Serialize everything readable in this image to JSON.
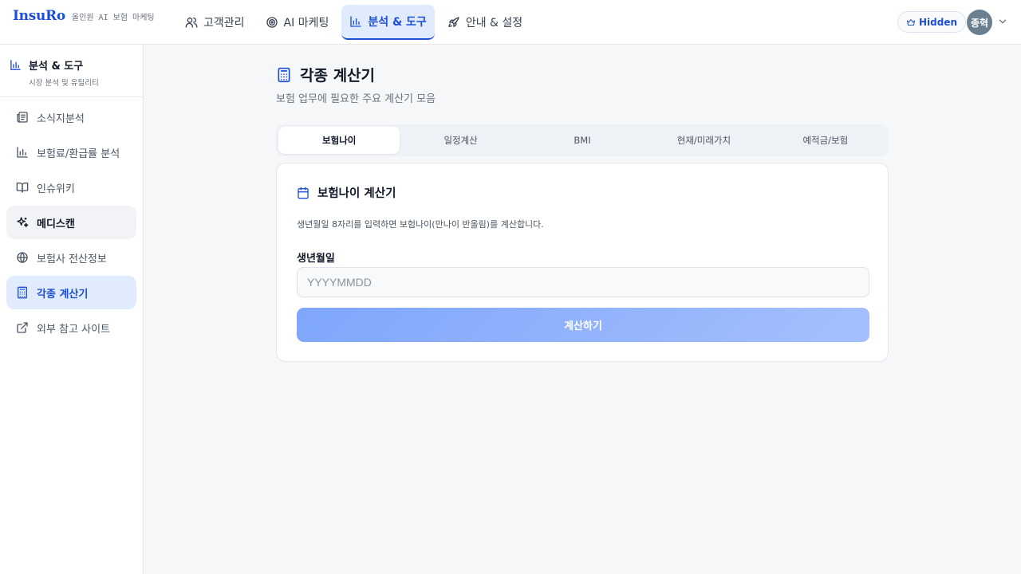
{
  "brand": {
    "name": "InsuRo",
    "tagline": "올인원 AI 보험 마케팅"
  },
  "nav": {
    "items": [
      {
        "label": "고객관리",
        "icon": "users-icon"
      },
      {
        "label": "AI 마케팅",
        "icon": "target-icon"
      },
      {
        "label": "분석 & 도구",
        "icon": "bar-chart-icon"
      },
      {
        "label": "안내 & 설정",
        "icon": "rocket-icon"
      }
    ]
  },
  "user": {
    "badge_label": "Hidden",
    "badge_icon": "crown-icon",
    "avatar_text": "종혁"
  },
  "sidebar": {
    "title": "분석 & 도구",
    "subtitle": "시장 분석 및 유틸리티",
    "items": [
      {
        "label": "소식지분석",
        "icon": "newspaper-icon"
      },
      {
        "label": "보험료/환급률 분석",
        "icon": "bar-chart-icon"
      },
      {
        "label": "인슈위키",
        "icon": "book-open-icon"
      },
      {
        "label": "메디스캔",
        "icon": "sparkles-icon"
      },
      {
        "label": "보험사 전산정보",
        "icon": "globe-icon"
      },
      {
        "label": "각종 계산기",
        "icon": "calculator-icon"
      },
      {
        "label": "외부 참고 사이트",
        "icon": "external-link-icon"
      }
    ]
  },
  "main": {
    "title": "각종 계산기",
    "subtitle": "보험 업무에 필요한 주요 계산기 모음",
    "tabs": [
      "보험나이",
      "일정계산",
      "BMI",
      "현재/미래가치",
      "예적금/보험"
    ],
    "card": {
      "title": "보험나이 계산기",
      "description": "생년월일 8자리를 입력하면 보험나이(만나이 반올림)를 계산합니다.",
      "field_label": "생년월일",
      "field_placeholder": "YYYYMMDD",
      "field_value": "",
      "button_label": "계산하기"
    }
  },
  "colors": {
    "accent": "#1d4ed8",
    "active_bg": "#e0ebfd",
    "button_from": "#7ea6fb",
    "button_to": "#a5c0fd"
  }
}
